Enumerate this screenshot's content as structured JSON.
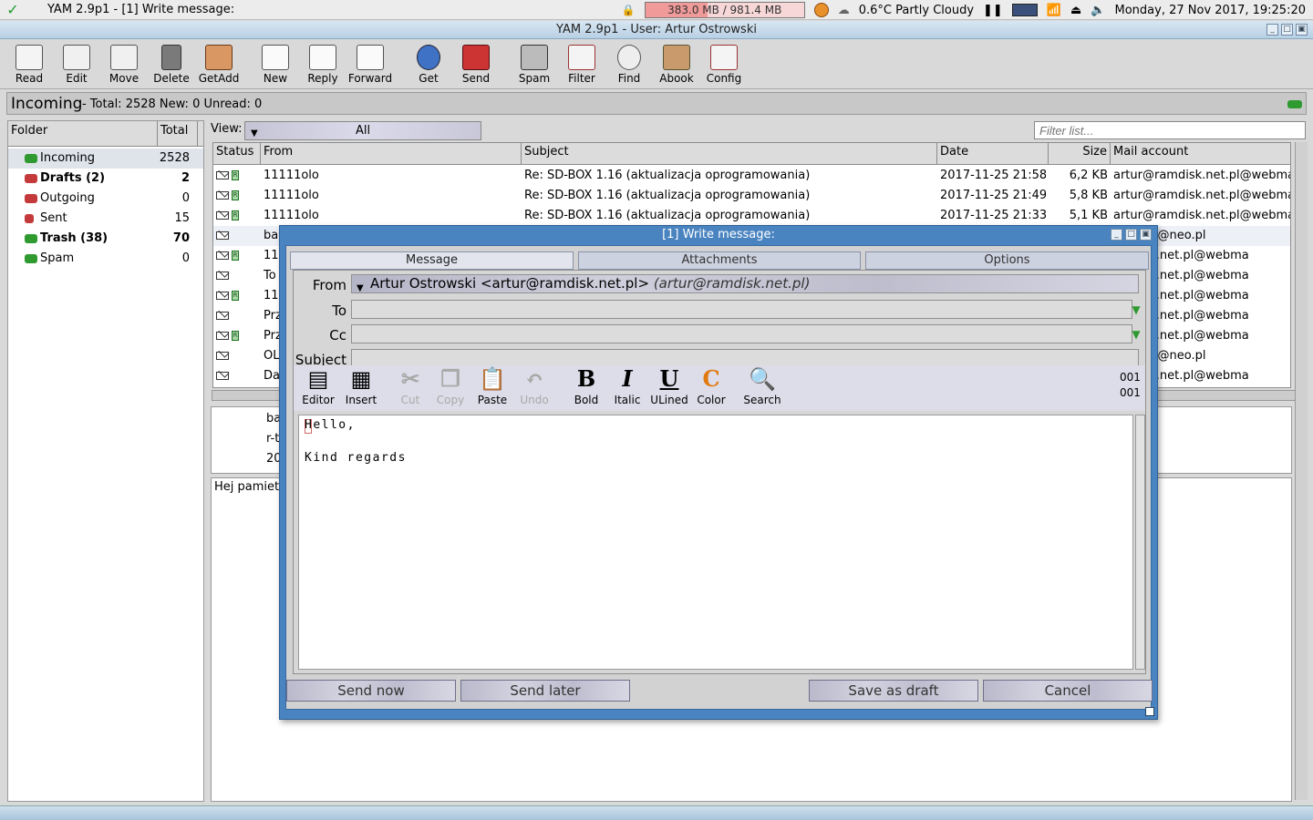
{
  "system_bar": {
    "app_title": "YAM 2.9p1 - [1] Write message:",
    "memory": "383.0 MB / 981.4 MB",
    "weather": "0.6°C Partly Cloudy",
    "datetime": "Monday, 27 Nov 2017, 19:25:20"
  },
  "window": {
    "title": "YAM 2.9p1 - User: Artur Ostrowski"
  },
  "toolbar": {
    "read": "Read",
    "edit": "Edit",
    "move": "Move",
    "delete": "Delete",
    "getadd": "GetAdd",
    "new": "New",
    "reply": "Reply",
    "forward": "Forward",
    "get": "Get",
    "send": "Send",
    "spam": "Spam",
    "filter": "Filter",
    "find": "Find",
    "abook": "Abook",
    "config": "Config"
  },
  "header": {
    "folder_name": "Incoming",
    "stats": "- Total: 2528 New: 0 Unread: 0"
  },
  "folder_panel": {
    "col_folder": "Folder",
    "col_total": "Total",
    "items": [
      {
        "name": "Incoming",
        "count": "2528",
        "color": "#2f9a2f"
      },
      {
        "name": "Drafts (2)",
        "count": "2",
        "color": "#c43a3a"
      },
      {
        "name": "Outgoing",
        "count": "0",
        "color": "#c43a3a"
      },
      {
        "name": "Sent",
        "count": "15",
        "color": "#c43a3a"
      },
      {
        "name": "Trash (38)",
        "count": "70",
        "color": "#2f9a2f"
      },
      {
        "name": "Spam",
        "count": "0",
        "color": "#2f9a2f"
      }
    ]
  },
  "view": {
    "label": "View:",
    "value": "All",
    "filter_placeholder": "Filter list..."
  },
  "message_list": {
    "columns": {
      "status": "Status",
      "from": "From",
      "subject": "Subject",
      "date": "Date",
      "size": "Size",
      "account": "Mail account"
    },
    "rows": [
      {
        "from": "11111olo",
        "subject": "Re: SD-BOX 1.16 (aktualizacja oprogramowania)",
        "date": "2017-11-25 21:58",
        "size": "6,2 KB",
        "account": "artur@ramdisk.net.pl@webma",
        "replied": true
      },
      {
        "from": "11111olo",
        "subject": "Re: SD-BOX 1.16 (aktualizacja oprogramowania)",
        "date": "2017-11-25 21:49",
        "size": "5,8 KB",
        "account": "artur@ramdisk.net.pl@webma",
        "replied": true
      },
      {
        "from": "11111olo",
        "subject": "Re: SD-BOX 1.16 (aktualizacja oprogramowania)",
        "date": "2017-11-25 21:33",
        "size": "5,1 KB",
        "account": "artur@ramdisk.net.pl@webma",
        "replied": true
      },
      {
        "from": "ba",
        "subject": "",
        "date": "",
        "size": "",
        "account": "miga.pl@neo.pl",
        "replied": false
      },
      {
        "from": "11",
        "subject": "",
        "date": "",
        "size": "",
        "account": "amdisk.net.pl@webma",
        "replied": true
      },
      {
        "from": "To",
        "subject": "",
        "date": "",
        "size": "",
        "account": "amdisk.net.pl@webma",
        "replied": false
      },
      {
        "from": "11",
        "subject": "",
        "date": "",
        "size": "",
        "account": "amdisk.net.pl@webma",
        "replied": true
      },
      {
        "from": "Prz",
        "subject": "",
        "date": "",
        "size": "",
        "account": "amdisk.net.pl@webma",
        "replied": false
      },
      {
        "from": "Prz",
        "subject": "",
        "date": "",
        "size": "",
        "account": "amdisk.net.pl@webma",
        "replied": true
      },
      {
        "from": "OL",
        "subject": "",
        "date": "",
        "size": "",
        "account": "miga.pl@neo.pl",
        "replied": false
      },
      {
        "from": "Da",
        "subject": "",
        "date": "",
        "size": "",
        "account": "amdisk.net.pl@webma",
        "replied": false
      }
    ]
  },
  "preview": {
    "header_lines": [
      "ba",
      "r-t",
      "20"
    ],
    "body": "Hej pamiet"
  },
  "compose": {
    "title": "[1] Write message:",
    "tabs": [
      "Message",
      "Attachments",
      "Options"
    ],
    "from_label": "From",
    "from_value": "Artur Ostrowski <artur@ramdisk.net.pl>",
    "from_alias": "(artur@ramdisk.net.pl)",
    "to_label": "To",
    "to_value": "",
    "cc_label": "Cc",
    "cc_value": "",
    "subject_label": "Subject",
    "subject_value": "",
    "editor_tools": {
      "editor": "Editor",
      "insert": "Insert",
      "cut": "Cut",
      "copy": "Copy",
      "paste": "Paste",
      "undo": "Undo",
      "bold": "Bold",
      "italic": "Italic",
      "ulined": "ULined",
      "color": "Color",
      "search": "Search"
    },
    "line_counter": "001",
    "col_counter": "001",
    "body_lines": [
      "Hello,",
      "",
      "Kind regards"
    ],
    "buttons": {
      "send_now": "Send now",
      "send_later": "Send later",
      "save_draft": "Save as draft",
      "cancel": "Cancel"
    }
  }
}
